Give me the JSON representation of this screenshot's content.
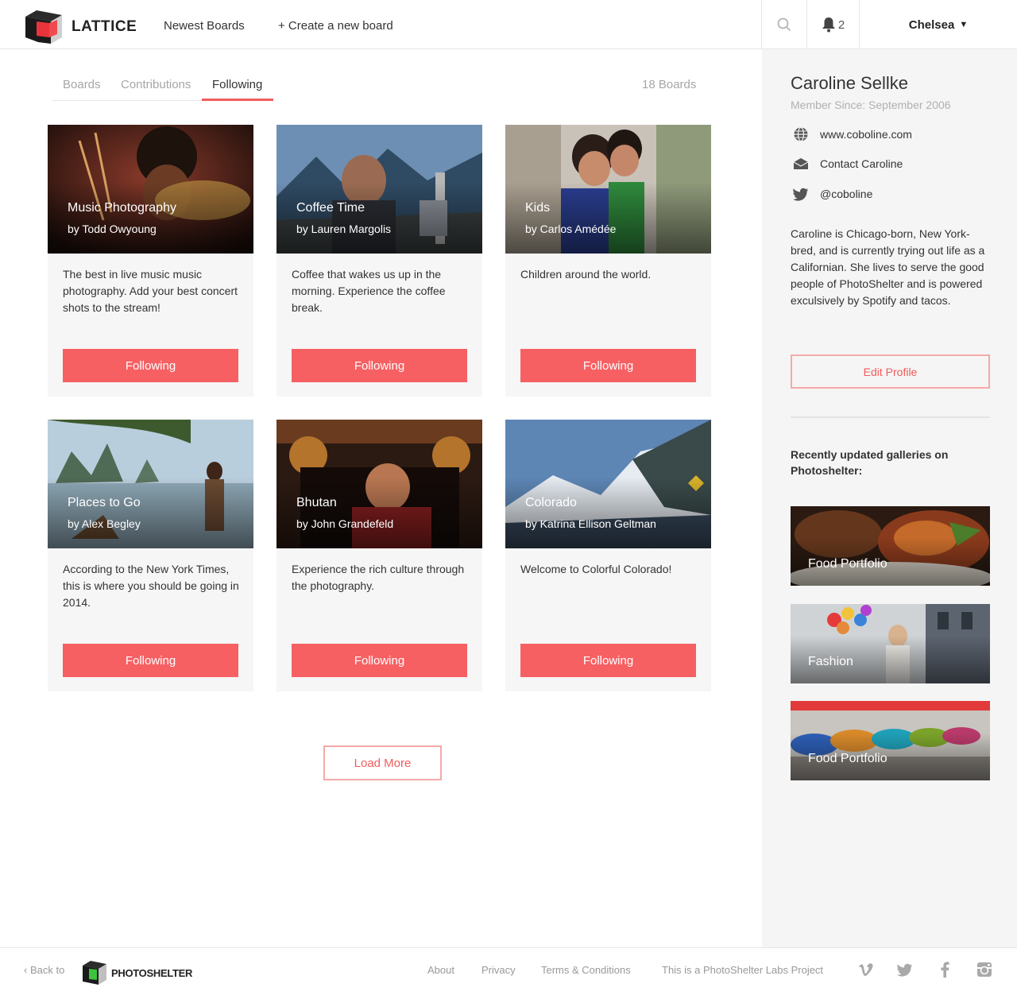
{
  "header": {
    "brand": "LATTICE",
    "nav": [
      "Newest Boards",
      "+ Create a new board"
    ],
    "notification_count": "2",
    "user_name": "Chelsea"
  },
  "tabs": [
    {
      "label": "Boards",
      "active": false
    },
    {
      "label": "Contributions",
      "active": false
    },
    {
      "label": "Following",
      "active": true
    }
  ],
  "boards_count": "18 Boards",
  "cards": [
    {
      "title": "Music Photography",
      "author": "by Todd Owyoung",
      "description": "The best in live music music photography. Add your best concert shots to the stream!",
      "button": "Following"
    },
    {
      "title": "Coffee Time",
      "author": "by Lauren Margolis",
      "description": "Coffee that wakes us up in the morning. Experience the coffee break.",
      "button": "Following"
    },
    {
      "title": "Kids",
      "author": "by Carlos Amédée",
      "description": "Children around the world.",
      "button": "Following"
    },
    {
      "title": "Places to Go",
      "author": "by Alex Begley",
      "description": "According to the New York Times, this is where you should be going in 2014.",
      "button": "Following"
    },
    {
      "title": "Bhutan",
      "author": "by John Grandefeld",
      "description": "Experience the rich culture through the photography.",
      "button": "Following"
    },
    {
      "title": "Colorado",
      "author": "by Katrina Ellison Geltman",
      "description": "Welcome to Colorful Colorado!",
      "button": "Following"
    }
  ],
  "load_more": "Load More",
  "profile": {
    "name": "Caroline Sellke",
    "member_since": "Member Since: September 2006",
    "website": "www.coboline.com",
    "contact": "Contact Caroline",
    "twitter": "@coboline",
    "bio": "Caroline is Chicago-born, New York-bred, and is currently trying out life as a Californian. She lives to serve the good people of PhotoShelter and is powered exculsively by Spotify and tacos.",
    "edit_button": "Edit Profile"
  },
  "recent": {
    "title": "Recently updated galleries on Photoshelter:",
    "galleries": [
      "Food Portfolio",
      "Fashion",
      "Food Portfolio"
    ]
  },
  "footer": {
    "back_to": "‹ Back to",
    "brand": "PHOTOSHELTER",
    "links": [
      "About",
      "Privacy",
      "Terms & Conditions",
      "This is a PhotoShelter Labs Project"
    ]
  },
  "colors": {
    "accent": "#f66063",
    "accent_outline": "#f5a9a9"
  }
}
